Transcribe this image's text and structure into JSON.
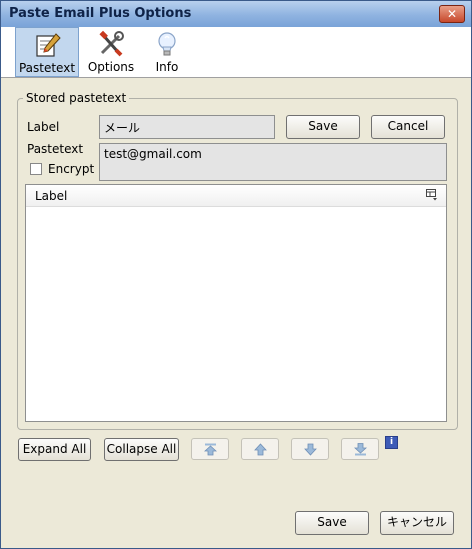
{
  "window": {
    "title": "Paste Email Plus Options",
    "close_glyph": "✕"
  },
  "toolbar": {
    "items": [
      {
        "label": "Pastetext",
        "icon": "notepad-pencil-icon",
        "active": true
      },
      {
        "label": "Options",
        "icon": "tools-icon",
        "active": false
      },
      {
        "label": "Info",
        "icon": "lightbulb-icon",
        "active": false
      }
    ]
  },
  "stored": {
    "legend": "Stored pastetext",
    "label_caption": "Label",
    "label_value": "メール",
    "save_label": "Save",
    "cancel_label": "Cancel",
    "pastetext_caption": "Pastetext",
    "pastetext_value": "test@gmail.com",
    "encrypt_label": "Encrypt",
    "encrypt_checked": false
  },
  "list": {
    "columns": [
      "Label"
    ],
    "rows": [],
    "column_picker_icon": "column-picker-icon"
  },
  "actions": {
    "expand_all": "Expand All",
    "collapse_all": "Collapse All",
    "move_buttons": [
      "move-top-icon",
      "move-up-icon",
      "move-down-icon",
      "move-bottom-icon"
    ],
    "info_glyph": "i"
  },
  "footer": {
    "save_label": "Save",
    "cancel_label": "キャンセル"
  }
}
